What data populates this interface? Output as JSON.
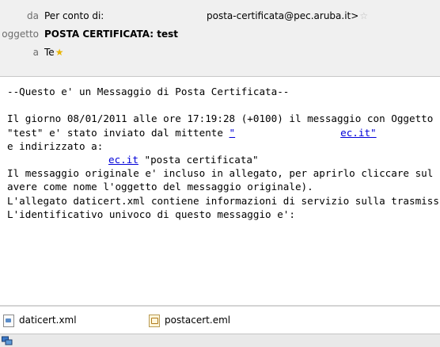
{
  "header": {
    "from_label": "da",
    "from_value": "Per conto di:",
    "from_address": "posta-certificata@pec.aruba.it>",
    "subject_label": "oggetto",
    "subject_value": "POSTA CERTIFICATA: test",
    "to_label": "a",
    "to_value": "Te"
  },
  "message": {
    "line1": "--Questo e' un Messaggio di Posta Certificata--",
    "line2": "Il giorno 08/01/2011 alle ore 17:19:28 (+0100) il messaggio con Oggetto",
    "line3_a": "\"test\" e' stato inviato dal mittente ",
    "line3_link_start": "\"",
    "line3_link_end": "ec.it\"",
    "line4": "e indirizzato a:",
    "line5_link": "ec.it",
    "line5_text": " \"posta certificata\"",
    "line6": "Il messaggio originale e' incluso in allegato, per aprirlo cliccare sul file",
    "line7": "avere come nome l'oggetto del messaggio originale).",
    "line8": "L'allegato daticert.xml contiene informazioni di servizio sulla trasmissione",
    "line9": "L'identificativo univoco di questo messaggio e':"
  },
  "attachments": [
    {
      "name": "daticert.xml",
      "icon": "xml-file-icon"
    },
    {
      "name": "postacert.eml",
      "icon": "eml-file-icon"
    }
  ],
  "colors": {
    "link": "#0000d8",
    "header_bg": "#f0f0f0",
    "label": "#6d6d6d"
  }
}
